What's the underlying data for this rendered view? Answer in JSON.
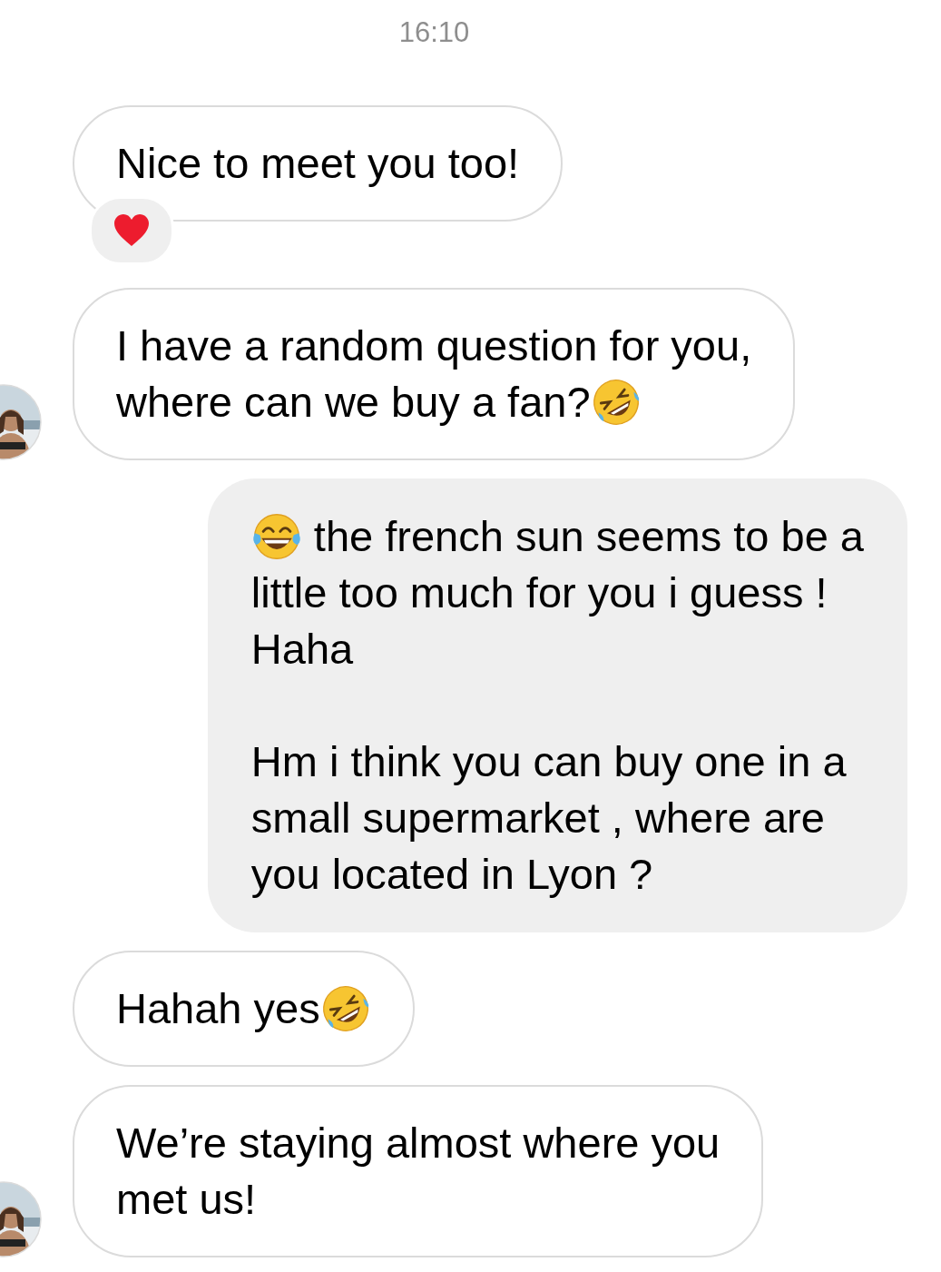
{
  "timestamp": "16:10",
  "messages": [
    {
      "kind": "received",
      "avatar": false,
      "reaction": true,
      "paragraphs": [
        [
          [
            {
              "kind": "text",
              "text": "Nice to meet you too!"
            }
          ]
        ]
      ]
    },
    {
      "kind": "received",
      "avatar": true,
      "reaction": false,
      "paragraphs": [
        [
          [
            {
              "kind": "text",
              "text": "I have a random question for you,"
            }
          ],
          [
            {
              "kind": "text",
              "text": "where can we buy a fan?"
            },
            {
              "kind": "rofl"
            }
          ]
        ]
      ]
    },
    {
      "kind": "sent",
      "reaction": false,
      "paragraphs": [
        [
          [
            {
              "kind": "tears"
            },
            {
              "kind": "text",
              "text": " the french sun seems to be a"
            }
          ],
          [
            {
              "kind": "text",
              "text": "little too much for you i guess !\nHaha"
            }
          ]
        ],
        [
          [
            {
              "kind": "text",
              "text": "Hm i think you can buy one in a\nsmall supermarket , where are\nyou located in Lyon ?"
            }
          ]
        ]
      ]
    },
    {
      "kind": "received",
      "avatar": false,
      "reaction": false,
      "paragraphs": [
        [
          [
            {
              "kind": "text",
              "text": "Hahah yes"
            },
            {
              "kind": "rofl"
            }
          ]
        ]
      ]
    },
    {
      "kind": "received",
      "avatar": true,
      "reaction": false,
      "paragraphs": [
        [
          [
            {
              "kind": "text",
              "text": "We’re staying almost where you\nmet us!"
            }
          ]
        ]
      ]
    }
  ]
}
